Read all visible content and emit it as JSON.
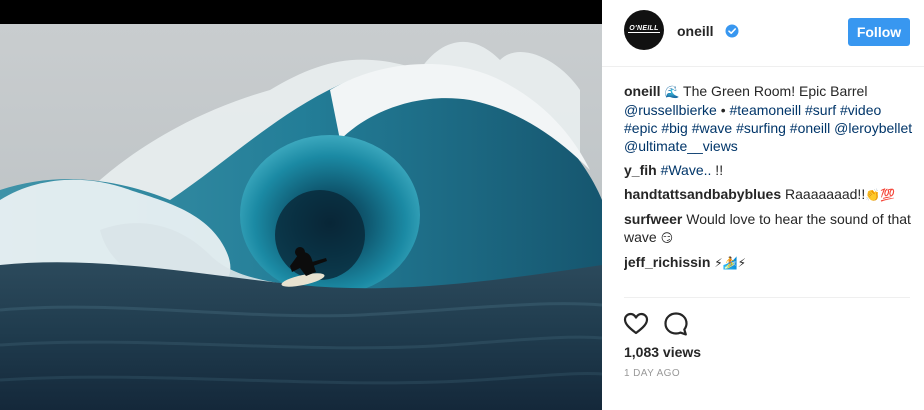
{
  "post": {
    "account": {
      "avatar_text": "O'NEILL",
      "username": "oneill",
      "verified": true,
      "follow_label": "Follow",
      "accent_color": "#3897f0"
    },
    "caption": {
      "username": "oneill",
      "emoji": "🌊",
      "text": " The Green Room! Epic Barrel ",
      "parts": [
        "@russellbierke",
        " • ",
        "#teamoneill",
        " ",
        "#surf",
        " ",
        "#video",
        " ",
        "#epic",
        " ",
        "#big",
        " ",
        "#wave",
        " ",
        "#surfing",
        " ",
        "#oneill",
        " ",
        "@leroybellet",
        " ",
        "@ultimate__views"
      ]
    },
    "comments": [
      {
        "username": "y_fih",
        "parts": [
          {
            "t": "#Wave..",
            "link": true
          },
          {
            "t": " !!",
            "link": false
          }
        ]
      },
      {
        "username": "handtattsandbabyblues",
        "parts": [
          {
            "t": "Raaaaaaad!!",
            "link": false
          },
          {
            "t": "👏💯",
            "link": false
          }
        ]
      },
      {
        "username": "surfweer",
        "parts": [
          {
            "t": "Would love to hear the sound of that wave ",
            "link": false
          },
          {
            "t": "😏",
            "link": false
          }
        ]
      },
      {
        "username": "jeff_richissin",
        "parts": [
          {
            "t": "⚡🏄⚡",
            "link": false
          }
        ]
      }
    ],
    "actions": {
      "like_icon": "heart-icon",
      "comment_icon": "comment-icon"
    },
    "views": "1,083 views",
    "timestamp": "1 DAY AGO"
  }
}
